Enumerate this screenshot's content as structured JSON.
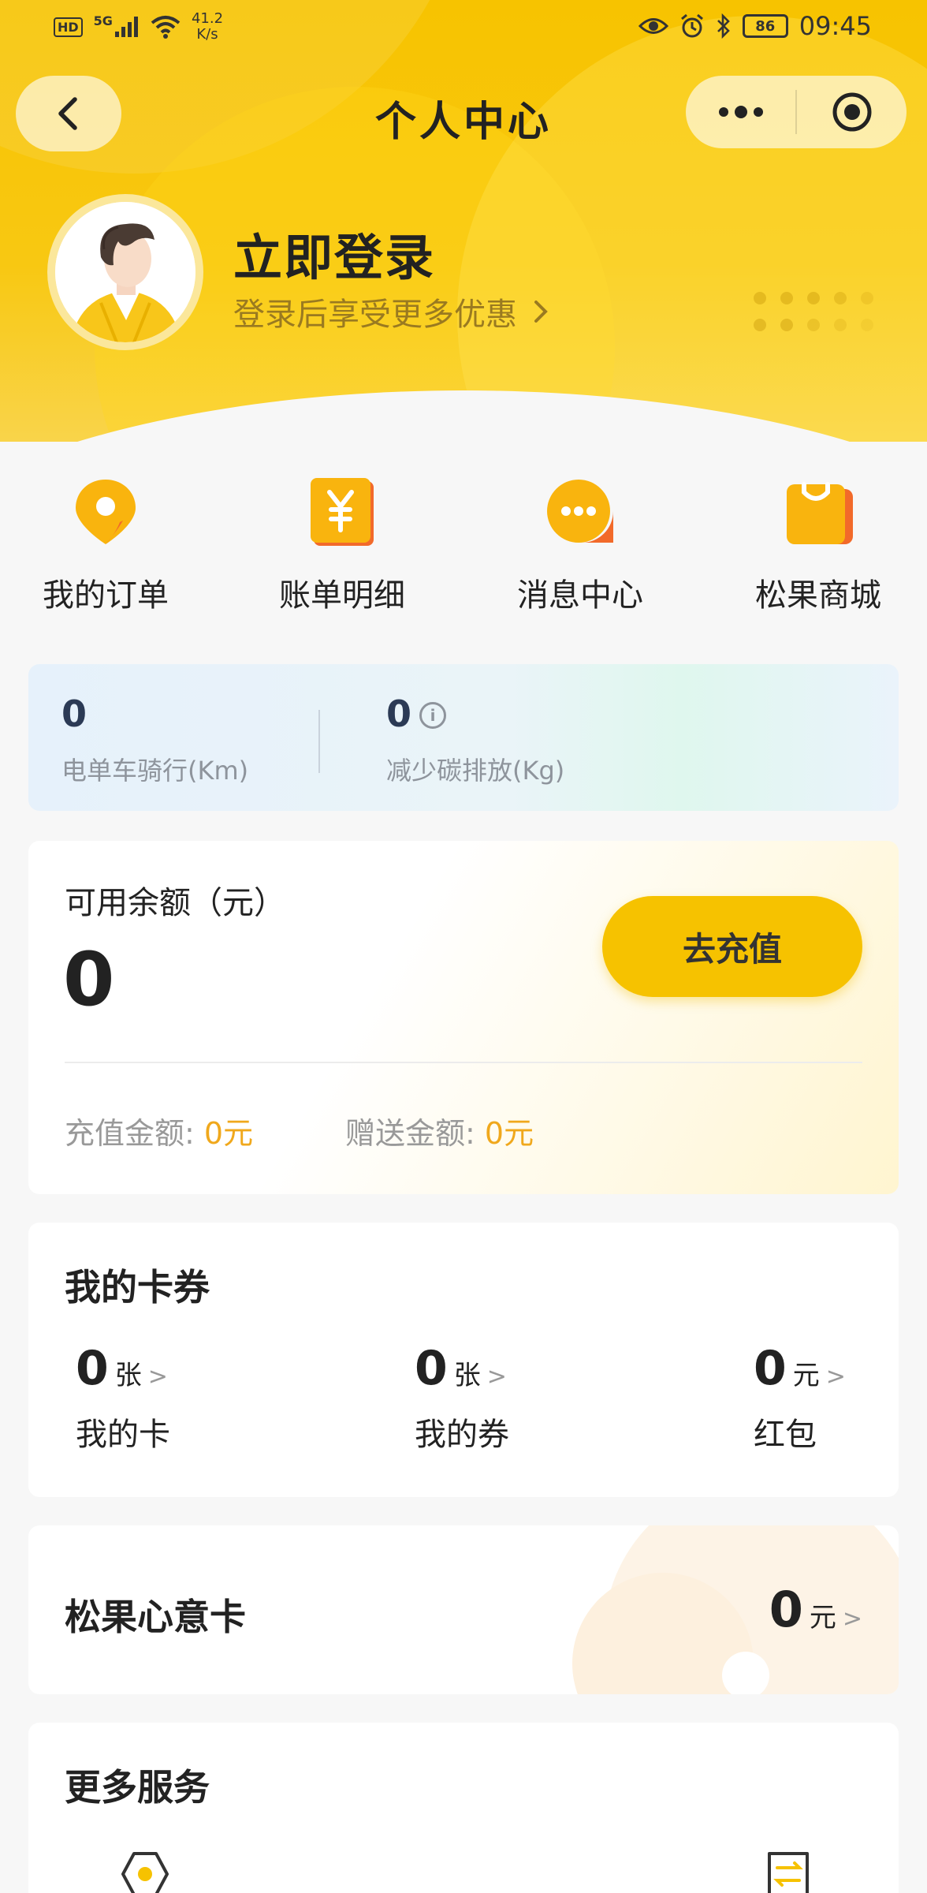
{
  "status_bar": {
    "hd": "HD",
    "network": "5G",
    "speed_value": "41.2",
    "speed_unit": "K/s",
    "battery": "86",
    "time": "09:45"
  },
  "nav": {
    "title": "个人中心"
  },
  "profile": {
    "login_title": "立即登录",
    "login_subtitle": "登录后享受更多优惠"
  },
  "quick_menu": [
    {
      "label": "我的订单",
      "icon": "location-pin-icon"
    },
    {
      "label": "账单明细",
      "icon": "yuan-bill-icon"
    },
    {
      "label": "消息中心",
      "icon": "chat-bubble-icon"
    },
    {
      "label": "松果商城",
      "icon": "shopping-bag-icon"
    }
  ],
  "carbon": {
    "ride_value": "0",
    "ride_label": "电单车骑行(Km)",
    "carbon_value": "0",
    "carbon_label": "减少碳排放(Kg)"
  },
  "balance": {
    "label": "可用余额（元）",
    "value": "0",
    "recharge_button": "去充值",
    "recharge_amount_label": "充值金额: ",
    "recharge_amount": "0元",
    "gift_amount_label": "赠送金额: ",
    "gift_amount": "0元"
  },
  "coupons": {
    "title": "我的卡券",
    "items": [
      {
        "value": "0",
        "unit": "张",
        "label": "我的卡"
      },
      {
        "value": "0",
        "unit": "张",
        "label": "我的券"
      },
      {
        "value": "0",
        "unit": "元",
        "label": "红包"
      }
    ]
  },
  "gift_card": {
    "title": "松果心意卡",
    "value": "0",
    "unit": "元"
  },
  "more_services": {
    "title": "更多服务"
  },
  "colors": {
    "brand_yellow": "#f6c200",
    "accent_orange": "#f0a81c"
  }
}
